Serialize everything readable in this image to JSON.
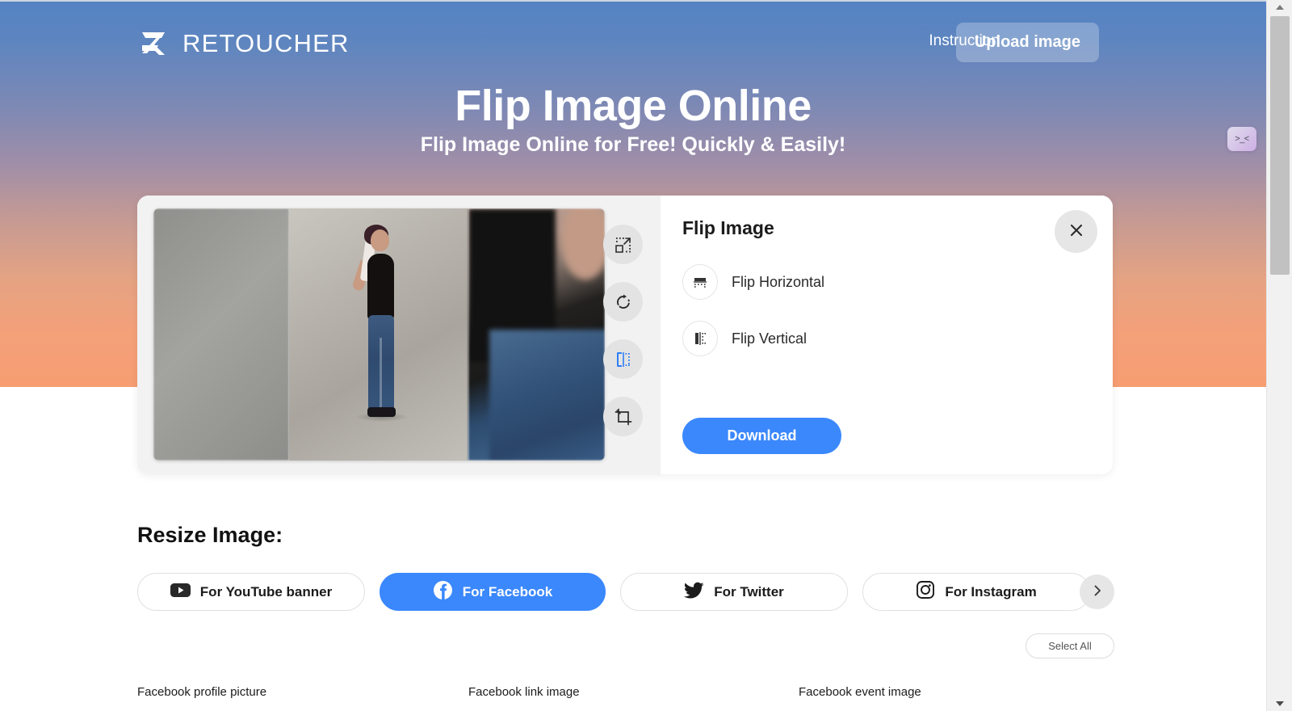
{
  "header": {
    "logo_text": "RETOUCHER",
    "logo_icon": "retoucher-logo-mark",
    "instruction_label": "Instruction",
    "upload_label": "Upload image"
  },
  "hero": {
    "title": "Flip Image Online",
    "subtitle": "Flip Image Online for Free! Quickly & Easily!"
  },
  "editor": {
    "tools": [
      {
        "name": "resize-icon",
        "title": "Resize"
      },
      {
        "name": "rotate-icon",
        "title": "Rotate"
      },
      {
        "name": "flip-icon",
        "title": "Flip",
        "active": true
      },
      {
        "name": "crop-icon",
        "title": "Crop"
      }
    ],
    "image_alt": "Woman in black tank top and jeans against gray wall"
  },
  "panel": {
    "title": "Flip Image",
    "close_icon": "close-icon",
    "options": [
      {
        "label": "Flip Horizontal",
        "icon": "flip-horizontal-icon"
      },
      {
        "label": "Flip Vertical",
        "icon": "flip-vertical-icon"
      }
    ],
    "download_label": "Download"
  },
  "resize": {
    "title": "Resize Image:",
    "chips": [
      {
        "label": "For YouTube banner",
        "icon": "youtube-icon",
        "active": false
      },
      {
        "label": "For Facebook",
        "icon": "facebook-icon",
        "active": true
      },
      {
        "label": "For Twitter",
        "icon": "twitter-icon",
        "active": false
      },
      {
        "label": "For Instagram",
        "icon": "instagram-icon",
        "active": false
      }
    ],
    "next_icon": "chevron-right-icon",
    "select_all_label": "Select All",
    "presets": [
      "Facebook profile picture",
      "Facebook link image",
      "Facebook event image"
    ]
  },
  "side_widget": {
    "face": ">_<"
  },
  "colors": {
    "accent": "#3b88fd",
    "hero_top": "#5483c4",
    "hero_bottom": "#f79d72",
    "panel_bg": "#ffffff",
    "editor_bg": "#f2f2f2"
  }
}
